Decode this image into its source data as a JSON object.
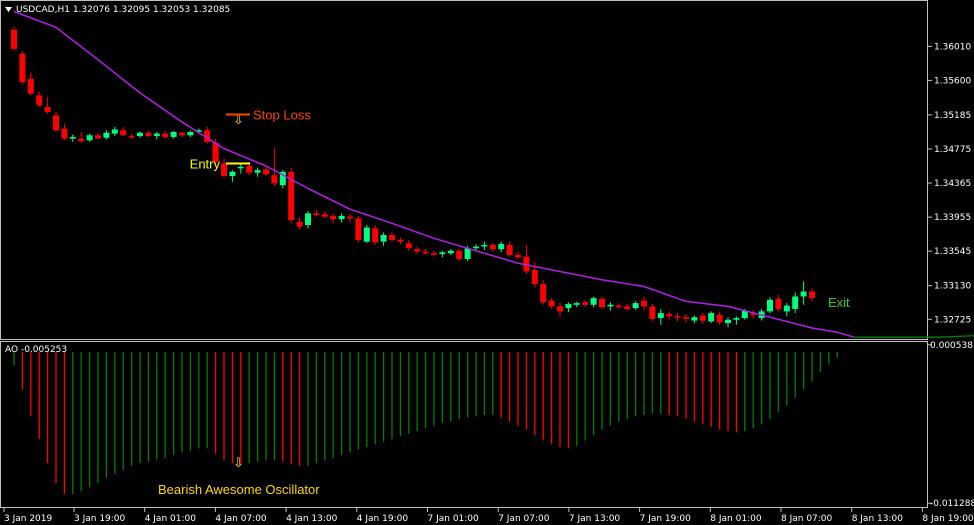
{
  "chart_data": [
    {
      "type": "candlestick",
      "header": "USDCAD,H1  1.32076 1.32095 1.32053 1.32085",
      "y_ticks": [
        "1.36010",
        "1.35600",
        "1.35185",
        "1.34775",
        "1.34365",
        "1.33955",
        "1.33545",
        "1.33130",
        "1.32725"
      ],
      "ylim": [
        1.325,
        1.3652
      ],
      "up_color": "#00ff7f",
      "down_color": "#ff0000",
      "ma_color": "#b41ee6",
      "candles": [
        [
          1.3621,
          1.3625,
          1.3596,
          1.3598
        ],
        [
          1.3592,
          1.3595,
          1.3555,
          1.3558
        ],
        [
          1.3562,
          1.357,
          1.3542,
          1.3544
        ],
        [
          1.3542,
          1.3547,
          1.3528,
          1.353
        ],
        [
          1.3528,
          1.354,
          1.352,
          1.3522
        ],
        [
          1.3518,
          1.3522,
          1.3498,
          1.35
        ],
        [
          1.3502,
          1.3508,
          1.3488,
          1.349
        ],
        [
          1.349,
          1.3495,
          1.3486,
          1.3492
        ],
        [
          1.349,
          1.3498,
          1.3485,
          1.3487
        ],
        [
          1.3488,
          1.3496,
          1.3486,
          1.3494
        ],
        [
          1.3494,
          1.3497,
          1.349,
          1.349
        ],
        [
          1.3491,
          1.35,
          1.3489,
          1.3497
        ],
        [
          1.3496,
          1.3504,
          1.3493,
          1.3501
        ],
        [
          1.35,
          1.3504,
          1.3493,
          1.3494
        ],
        [
          1.3493,
          1.3496,
          1.349,
          1.3492
        ],
        [
          1.3493,
          1.3499,
          1.3491,
          1.3497
        ],
        [
          1.3497,
          1.35,
          1.3492,
          1.3493
        ],
        [
          1.3493,
          1.3498,
          1.3489,
          1.3496
        ],
        [
          1.3496,
          1.3499,
          1.349,
          1.3492
        ],
        [
          1.3492,
          1.3499,
          1.349,
          1.3498
        ],
        [
          1.3497,
          1.3498,
          1.3492,
          1.3494
        ],
        [
          1.3494,
          1.35,
          1.3492,
          1.3498
        ],
        [
          1.3499,
          1.3502,
          1.3496,
          1.35
        ],
        [
          1.35,
          1.3504,
          1.3484,
          1.3486
        ],
        [
          1.3485,
          1.349,
          1.3458,
          1.3462
        ],
        [
          1.346,
          1.3466,
          1.3443,
          1.3445
        ],
        [
          1.3445,
          1.3452,
          1.3438,
          1.345
        ],
        [
          1.3455,
          1.346,
          1.3448,
          1.3456
        ],
        [
          1.3457,
          1.3462,
          1.3446,
          1.3449
        ],
        [
          1.3449,
          1.3455,
          1.3444,
          1.3452
        ],
        [
          1.3453,
          1.3458,
          1.3445,
          1.3447
        ],
        [
          1.3446,
          1.3479,
          1.3433,
          1.3436
        ],
        [
          1.3434,
          1.3452,
          1.343,
          1.345
        ],
        [
          1.345,
          1.3455,
          1.3388,
          1.3392
        ],
        [
          1.339,
          1.3395,
          1.3381,
          1.3384
        ],
        [
          1.3386,
          1.3403,
          1.3382,
          1.34
        ],
        [
          1.34,
          1.3404,
          1.3396,
          1.3398
        ],
        [
          1.3399,
          1.3402,
          1.3394,
          1.3396
        ],
        [
          1.3397,
          1.34,
          1.3388,
          1.3393
        ],
        [
          1.3393,
          1.34,
          1.3389,
          1.3397
        ],
        [
          1.3396,
          1.34,
          1.3389,
          1.3394
        ],
        [
          1.3394,
          1.3397,
          1.3365,
          1.3368
        ],
        [
          1.3366,
          1.3386,
          1.3364,
          1.3383
        ],
        [
          1.3382,
          1.3386,
          1.3362,
          1.3365
        ],
        [
          1.3366,
          1.3377,
          1.3361,
          1.3374
        ],
        [
          1.3374,
          1.3377,
          1.3366,
          1.3368
        ],
        [
          1.3368,
          1.3371,
          1.3363,
          1.3366
        ],
        [
          1.3364,
          1.3368,
          1.3355,
          1.3358
        ],
        [
          1.3357,
          1.336,
          1.3351,
          1.3354
        ],
        [
          1.3354,
          1.3357,
          1.335,
          1.3352
        ],
        [
          1.3352,
          1.3355,
          1.3348,
          1.3351
        ],
        [
          1.3351,
          1.3355,
          1.3347,
          1.3353
        ],
        [
          1.3352,
          1.3357,
          1.335,
          1.3355
        ],
        [
          1.3355,
          1.3357,
          1.3343,
          1.3345
        ],
        [
          1.3345,
          1.3361,
          1.3343,
          1.3358
        ],
        [
          1.3358,
          1.3363,
          1.3354,
          1.336
        ],
        [
          1.3361,
          1.3366,
          1.3356,
          1.3362
        ],
        [
          1.3362,
          1.3364,
          1.3354,
          1.3357
        ],
        [
          1.3357,
          1.3366,
          1.3353,
          1.3363
        ],
        [
          1.3362,
          1.3366,
          1.3348,
          1.335
        ],
        [
          1.335,
          1.3354,
          1.3345,
          1.3347
        ],
        [
          1.3348,
          1.3362,
          1.3327,
          1.333
        ],
        [
          1.3332,
          1.3341,
          1.3311,
          1.3315
        ],
        [
          1.3315,
          1.332,
          1.329,
          1.3293
        ],
        [
          1.3295,
          1.3298,
          1.3285,
          1.3288
        ],
        [
          1.3288,
          1.3293,
          1.3275,
          1.3282
        ],
        [
          1.3286,
          1.3293,
          1.3281,
          1.3291
        ],
        [
          1.329,
          1.3294,
          1.3287,
          1.3292
        ],
        [
          1.3293,
          1.3296,
          1.3287,
          1.329
        ],
        [
          1.329,
          1.33,
          1.3287,
          1.3298
        ],
        [
          1.3297,
          1.33,
          1.3285,
          1.3287
        ],
        [
          1.3288,
          1.3293,
          1.3283,
          1.329
        ],
        [
          1.3289,
          1.3292,
          1.3285,
          1.3288
        ],
        [
          1.3288,
          1.3291,
          1.3283,
          1.3285
        ],
        [
          1.3286,
          1.3294,
          1.3284,
          1.3292
        ],
        [
          1.3295,
          1.33,
          1.3283,
          1.3288
        ],
        [
          1.3288,
          1.3291,
          1.327,
          1.3273
        ],
        [
          1.3274,
          1.3285,
          1.3266,
          1.328
        ],
        [
          1.3279,
          1.3282,
          1.3272,
          1.3276
        ],
        [
          1.3276,
          1.328,
          1.327,
          1.3275
        ],
        [
          1.3275,
          1.3279,
          1.3269,
          1.3273
        ],
        [
          1.3271,
          1.3277,
          1.3268,
          1.3275
        ],
        [
          1.3277,
          1.328,
          1.3267,
          1.3271
        ],
        [
          1.327,
          1.3282,
          1.3268,
          1.328
        ],
        [
          1.3278,
          1.3282,
          1.3266,
          1.3269
        ],
        [
          1.3268,
          1.3275,
          1.3263,
          1.3272
        ],
        [
          1.3272,
          1.3276,
          1.3266,
          1.3274
        ],
        [
          1.3274,
          1.3285,
          1.3272,
          1.3283
        ],
        [
          1.328,
          1.3284,
          1.3273,
          1.3278
        ],
        [
          1.3274,
          1.3285,
          1.3271,
          1.3282
        ],
        [
          1.3282,
          1.3299,
          1.328,
          1.3296
        ],
        [
          1.3297,
          1.3302,
          1.3282,
          1.3285
        ],
        [
          1.3282,
          1.3292,
          1.3276,
          1.3289
        ],
        [
          1.3285,
          1.3305,
          1.328,
          1.33
        ],
        [
          1.33,
          1.3318,
          1.329,
          1.3306
        ],
        [
          1.3306,
          1.331,
          1.3294,
          1.3298
        ]
      ],
      "ma": [
        [
          0,
          1.3643
        ],
        [
          5,
          1.3624
        ],
        [
          10,
          1.3585
        ],
        [
          15,
          1.3545
        ],
        [
          20,
          1.351
        ],
        [
          25,
          1.3478
        ],
        [
          30,
          1.3457
        ],
        [
          35,
          1.343
        ],
        [
          40,
          1.3405
        ],
        [
          45,
          1.3388
        ],
        [
          50,
          1.337
        ],
        [
          55,
          1.3355
        ],
        [
          60,
          1.334
        ],
        [
          65,
          1.333
        ],
        [
          70,
          1.332
        ],
        [
          75,
          1.3312
        ],
        [
          80,
          1.3294
        ],
        [
          85,
          1.3288
        ],
        [
          90,
          1.3275
        ],
        [
          95,
          1.3262
        ],
        [
          98,
          1.3257
        ],
        [
          100,
          1.3251
        ]
      ],
      "trail_line": [
        [
          100,
          1.3251
        ],
        [
          110,
          1.3251
        ],
        [
          115,
          1.3253
        ],
        [
          118,
          1.3256
        ]
      ],
      "annotations": {
        "stop_loss": "Stop Loss",
        "stop_loss_color": "#ff4500",
        "stop_loss_price": 1.3519,
        "entry": "Entry",
        "entry_color": "#ffff00",
        "entry_price": 1.346,
        "exit": "Exit",
        "exit_color": "#32cd32",
        "arrow_color": "#ffd700"
      }
    },
    {
      "type": "histogram",
      "label": "AO -0.005253",
      "y_ticks": [
        "0.000538",
        "-0.011288"
      ],
      "ylim": [
        -0.0115,
        0.0006
      ],
      "up_color": "#008000",
      "down_color": "#ff0000",
      "caption": "Bearish Awesome Oscillator",
      "caption_color": "#ffd700",
      "values": [
        -0.001,
        -0.0028,
        -0.0048,
        -0.0065,
        -0.0083,
        -0.0098,
        -0.0106,
        -0.0106,
        -0.0104,
        -0.0101,
        -0.0098,
        -0.0094,
        -0.0091,
        -0.0088,
        -0.0085,
        -0.0083,
        -0.0082,
        -0.008,
        -0.0079,
        -0.0077,
        -0.0075,
        -0.0074,
        -0.0072,
        -0.0072,
        -0.0076,
        -0.0081,
        -0.0083,
        -0.0084,
        -0.0083,
        -0.0082,
        -0.0081,
        -0.0081,
        -0.0082,
        -0.0084,
        -0.0085,
        -0.0085,
        -0.0083,
        -0.0081,
        -0.0079,
        -0.0077,
        -0.0075,
        -0.0073,
        -0.0071,
        -0.0069,
        -0.0067,
        -0.0065,
        -0.0063,
        -0.0061,
        -0.0059,
        -0.0057,
        -0.0055,
        -0.0053,
        -0.0052,
        -0.005,
        -0.0049,
        -0.0048,
        -0.0047,
        -0.0047,
        -0.0049,
        -0.0052,
        -0.0055,
        -0.0058,
        -0.0062,
        -0.0066,
        -0.0069,
        -0.0071,
        -0.0072,
        -0.007,
        -0.0066,
        -0.0062,
        -0.0058,
        -0.0055,
        -0.0052,
        -0.005,
        -0.0048,
        -0.0047,
        -0.0046,
        -0.0046,
        -0.0047,
        -0.0048,
        -0.005,
        -0.0052,
        -0.0054,
        -0.0056,
        -0.0058,
        -0.0059,
        -0.006,
        -0.0059,
        -0.0057,
        -0.0054,
        -0.005,
        -0.0045,
        -0.004,
        -0.0034,
        -0.0028,
        -0.0022,
        -0.0015,
        -0.0009,
        -0.0004,
        0.0
      ]
    }
  ],
  "x_axis": {
    "labels": [
      "3 Jan 2019",
      "3 Jan 19:00",
      "4 Jan 01:00",
      "4 Jan 07:00",
      "4 Jan 13:00",
      "4 Jan 19:00",
      "7 Jan 01:00",
      "7 Jan 07:00",
      "7 Jan 13:00",
      "7 Jan 19:00",
      "8 Jan 01:00",
      "8 Jan 07:00",
      "8 Jan 13:00",
      "8 Jan 19:00"
    ]
  }
}
